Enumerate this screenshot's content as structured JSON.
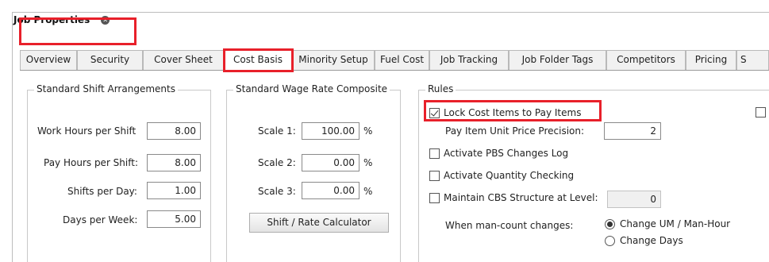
{
  "document_tab": {
    "title": "Job Properties"
  },
  "tabs": [
    {
      "label": "Overview"
    },
    {
      "label": "Security"
    },
    {
      "label": "Cover Sheet"
    },
    {
      "label": "Cost Basis"
    },
    {
      "label": "Minority Setup"
    },
    {
      "label": "Fuel Cost"
    },
    {
      "label": "Job Tracking"
    },
    {
      "label": "Job Folder Tags"
    },
    {
      "label": "Competitors"
    },
    {
      "label": "Pricing"
    },
    {
      "label": "S"
    }
  ],
  "active_tab": "Cost Basis",
  "shift": {
    "title": "Standard Shift Arrangements",
    "rows": [
      {
        "label": "Work Hours per Shift",
        "value": "8.00"
      },
      {
        "label": "Pay Hours per Shift:",
        "value": "8.00"
      },
      {
        "label": "Shifts per Day:",
        "value": "1.00"
      },
      {
        "label": "Days per Week:",
        "value": "5.00"
      }
    ]
  },
  "wage": {
    "title": "Standard Wage Rate Composite",
    "rows": [
      {
        "label": "Scale 1:",
        "value": "100.00",
        "unit": "%"
      },
      {
        "label": "Scale 2:",
        "value": "0.00",
        "unit": "%"
      },
      {
        "label": "Scale 3:",
        "value": "0.00",
        "unit": "%"
      }
    ],
    "button": "Shift / Rate Calculator"
  },
  "rules": {
    "title": "Rules",
    "lock_cost": {
      "label": "Lock Cost Items to Pay Items",
      "checked": true
    },
    "precision": {
      "label": "Pay Item Unit Price Precision:",
      "value": "2"
    },
    "pbs_log": {
      "label": "Activate PBS Changes Log",
      "checked": false
    },
    "qty_check": {
      "label": "Activate Quantity Checking",
      "checked": false
    },
    "cbs": {
      "label": "Maintain CBS Structure at Level:",
      "checked": false,
      "value": "0"
    },
    "mancount": {
      "label": "When man-count changes:",
      "options": [
        {
          "label": "Change UM / Man-Hour",
          "selected": true
        },
        {
          "label": "Change Days",
          "selected": false
        }
      ]
    }
  },
  "colors": {
    "highlight": "#e8202a"
  }
}
